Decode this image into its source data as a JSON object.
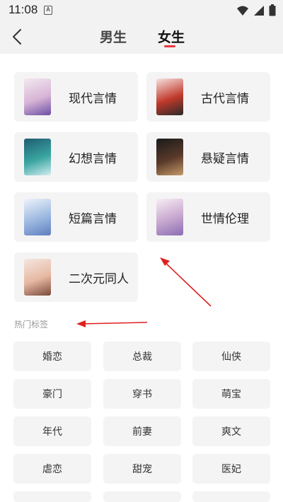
{
  "status": {
    "time": "11:08",
    "notif_glyph": "A"
  },
  "header": {
    "tabs": [
      {
        "label": "男生",
        "active": false
      },
      {
        "label": "女生",
        "active": true
      }
    ],
    "accent_color": "#e8383f"
  },
  "genres": [
    {
      "label": "现代言情",
      "cover_colors": [
        "#f3e8ef",
        "#d7b4d6",
        "#6b4ea3"
      ]
    },
    {
      "label": "古代言情",
      "cover_colors": [
        "#f6e2e0",
        "#c0392b",
        "#2a2a2a"
      ]
    },
    {
      "label": "幻想言情",
      "cover_colors": [
        "#1f5d73",
        "#3aa6a0",
        "#d2ecf2"
      ]
    },
    {
      "label": "悬疑言情",
      "cover_colors": [
        "#1a1a1a",
        "#5a3a2a",
        "#c59a6a"
      ]
    },
    {
      "label": "短篇言情",
      "cover_colors": [
        "#eef3fb",
        "#9cb8e0",
        "#5e7fbf"
      ]
    },
    {
      "label": "世情伦理",
      "cover_colors": [
        "#f7eef3",
        "#c7a6cf",
        "#8a6db3"
      ]
    },
    {
      "label": "二次元同人",
      "cover_colors": [
        "#f5e6df",
        "#e6b8a2",
        "#7a4a3a"
      ]
    }
  ],
  "hot_tags": {
    "title": "热门标签",
    "tags": [
      "婚恋",
      "总裁",
      "仙侠",
      "豪门",
      "穿书",
      "萌宝",
      "年代",
      "前妻",
      "爽文",
      "虐恋",
      "甜宠",
      "医妃"
    ]
  }
}
